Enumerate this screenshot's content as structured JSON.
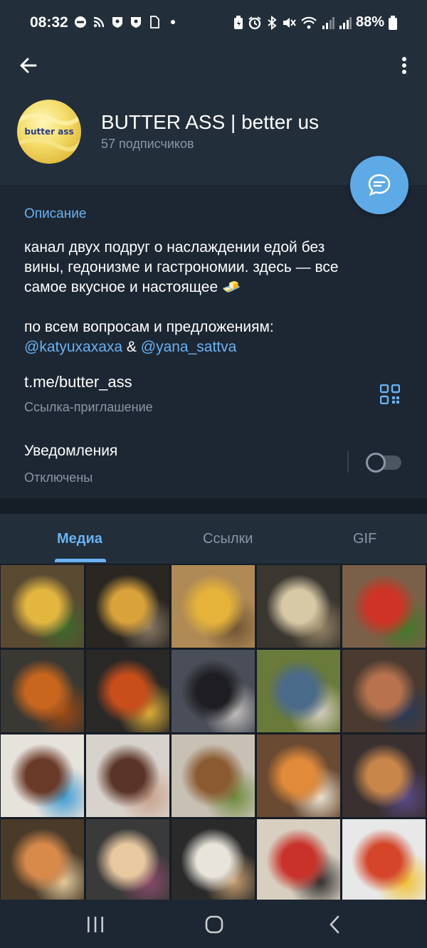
{
  "status_bar": {
    "time": "08:32",
    "battery_pct": "88%",
    "left_icons": [
      "do-not-disturb-icon",
      "rss-icon",
      "shield-icon",
      "shield-icon",
      "document-icon",
      "dot-icon"
    ],
    "right_icons": [
      "battery-saver-icon",
      "alarm-icon",
      "bluetooth-icon",
      "mute-icon",
      "wifi-icon",
      "signal-icon",
      "signal-icon",
      "battery-icon"
    ]
  },
  "header": {
    "channel_title": "BUTTER ASS | better us",
    "subscribers": "57 подписчиков",
    "avatar_text": "butter ass"
  },
  "info": {
    "description_label": "Описание",
    "description_lines": [
      "канал двух подруг о наслаждении едой без",
      "вины, гедонизме и гастрономии. здесь — все",
      "самое вкусное и настоящее 🧈"
    ],
    "contact_line": "по всем вопросам и предложениям:",
    "mention_1": "@katyuxaxaxa",
    "mention_sep": " & ",
    "mention_2": "@yana_sattva",
    "link": "t.me/butter_ass",
    "link_sub": "Ссылка-приглашение",
    "notifications_label": "Уведомления",
    "notifications_state": "Отключены",
    "notifications_on": false
  },
  "tabs": [
    {
      "label": "Медиа",
      "active": true
    },
    {
      "label": "Ссылки",
      "active": false
    },
    {
      "label": "GIF",
      "active": false
    }
  ],
  "media": [
    {
      "colors": [
        "#5a4a32",
        "#e3b640",
        "#3c6a2c"
      ]
    },
    {
      "colors": [
        "#2a2622",
        "#d9a23a",
        "#8a7a66"
      ]
    },
    {
      "colors": [
        "#b08a55",
        "#e5b23a",
        "#6d5232"
      ]
    },
    {
      "colors": [
        "#3a3630",
        "#d8c9a6",
        "#9a8868"
      ]
    },
    {
      "colors": [
        "#7a6048",
        "#cf3325",
        "#3f7a2a"
      ]
    },
    {
      "colors": [
        "#3a3832",
        "#c9661e",
        "#a04a14"
      ]
    },
    {
      "colors": [
        "#2a2826",
        "#c84e1c",
        "#e3b33a"
      ]
    },
    {
      "colors": [
        "#4a4e58",
        "#1e1e22",
        "#c8c4c0"
      ]
    },
    {
      "colors": [
        "#6a7a3a",
        "#4a6a8a",
        "#d9d0c4"
      ]
    },
    {
      "colors": [
        "#4a3a30",
        "#b8734e",
        "#2a3a5a"
      ]
    },
    {
      "colors": [
        "#e6e2dc",
        "#6a3a28",
        "#3a9ad4"
      ]
    },
    {
      "colors": [
        "#d8d2cc",
        "#5a3426",
        "#c9a08a"
      ]
    },
    {
      "colors": [
        "#c8c0b4",
        "#8a5a30",
        "#6a8a3a"
      ]
    },
    {
      "colors": [
        "#6a4a32",
        "#e08a3a",
        "#f0e8d8"
      ]
    },
    {
      "colors": [
        "#3a3030",
        "#c8864a",
        "#5a4a8a"
      ]
    },
    {
      "colors": [
        "#4a3a2a",
        "#d88a4a",
        "#e8d0a0"
      ]
    },
    {
      "colors": [
        "#3a3a3a",
        "#e8c8a0",
        "#8a4a6a"
      ]
    },
    {
      "colors": [
        "#2a2a2a",
        "#e8e4dc",
        "#c8a070"
      ]
    },
    {
      "colors": [
        "#d8cfc0",
        "#c8322a",
        "#2a2a2a"
      ]
    },
    {
      "colors": [
        "#e8e8e8",
        "#d4452a",
        "#f0c030"
      ]
    }
  ],
  "colors": {
    "accent": "#6ab2f2",
    "header_bg": "#222e3a",
    "body_bg": "#1d2733",
    "fab": "#5eaae6"
  }
}
